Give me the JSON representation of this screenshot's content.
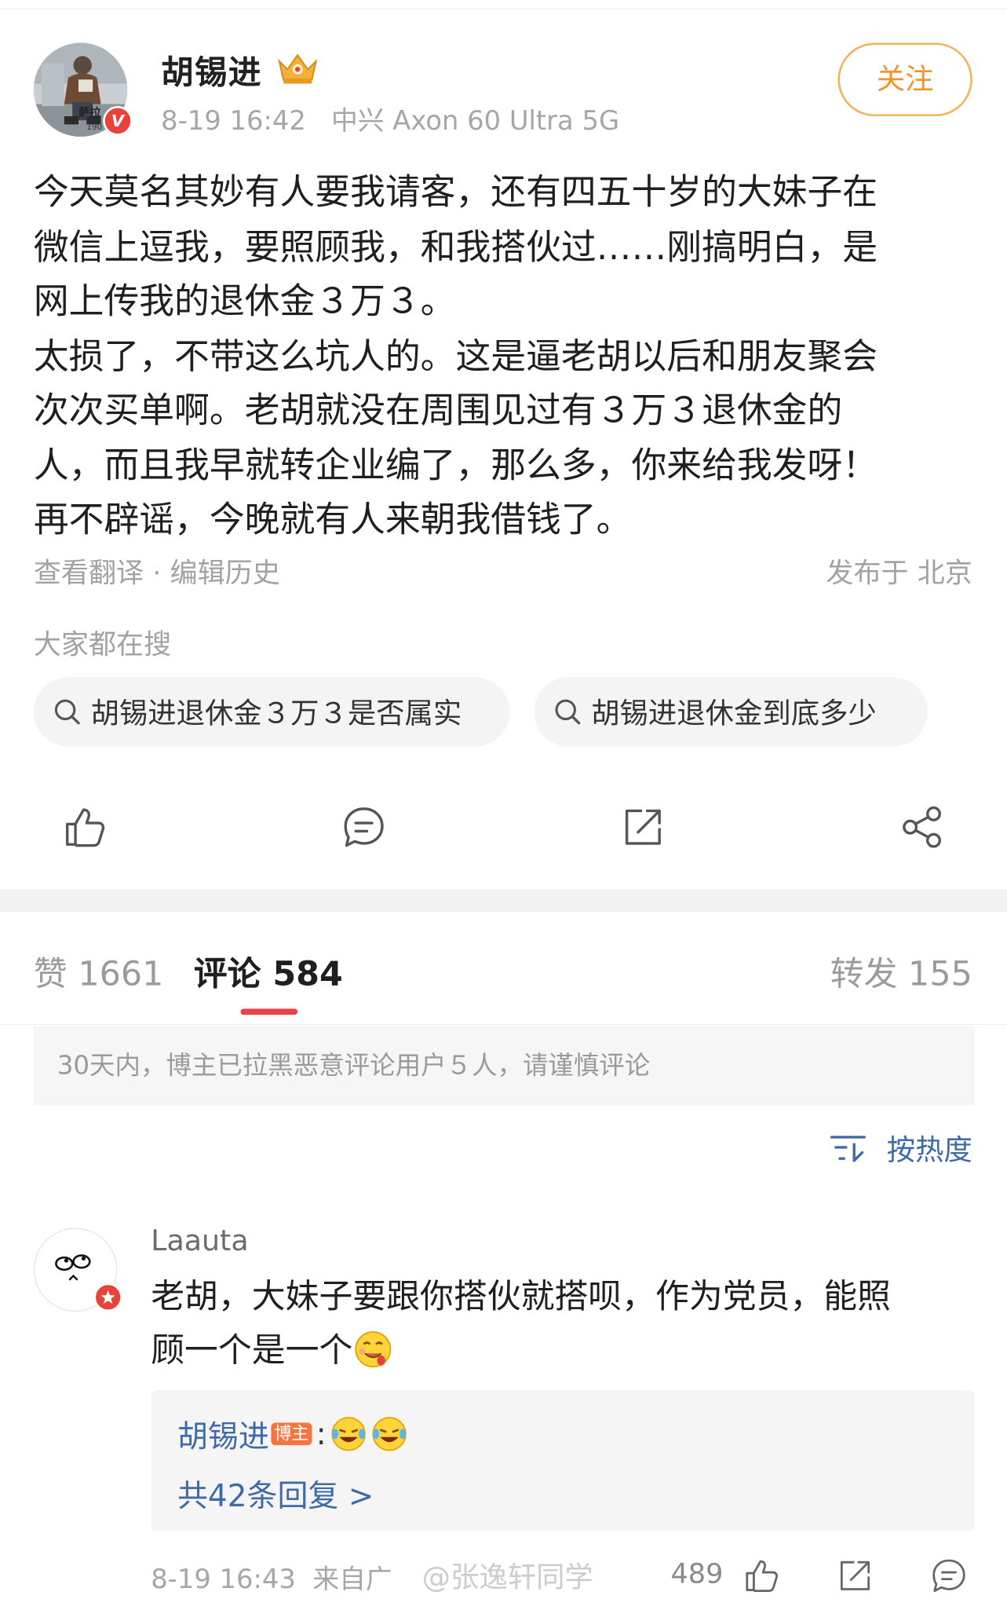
{
  "post": {
    "author": "胡锡进",
    "time": "8-19 16:42",
    "device": "中兴 Axon 60 Ultra 5G",
    "follow_label": "关注",
    "avatar_caption": "萨拉",
    "avatar_number": "190",
    "lines": [
      "今天莫名其妙有人要我请客，还有四五十岁的大妹子在",
      "微信上逗我，要照顾我，和我搭伙过……刚搞明白，是",
      "网上传我的退休金３万３。",
      "太损了，不带这么坑人的。这是逼老胡以后和朋友聚会",
      "次次买单啊。老胡就没在周围见过有３万３退休金的",
      "人，而且我早就转企业编了，那么多，你来给我发呀！",
      "再不辟谣，今晚就有人来朝我借钱了。"
    ],
    "translate_edit": "查看翻译 · 编辑历史",
    "location": "发布于 北京"
  },
  "hot_search": {
    "title": "大家都在搜",
    "chips": [
      "胡锡进退休金３万３是否属实",
      "胡锡进退休金到底多少"
    ]
  },
  "actions": [
    "like-icon",
    "comment-icon",
    "repost-icon",
    "share-icon"
  ],
  "tabs": {
    "likes": "赞 1661",
    "comments": "评论 584",
    "reposts": "转发 155"
  },
  "notice": "30天内，博主已拉黑恶意评论用户５人，请谨慎评论",
  "sort_label": "按热度",
  "comment": {
    "user": "Laauta",
    "text_line1": "老胡，大妹子要跟你搭伙就搭呗，作为党员，能照",
    "text_line2": "顾一个是一个",
    "reply_author": "胡锡进",
    "reply_badge": "博主",
    "reply_more": "共42条回复 >",
    "time": "8-19 16:43",
    "source": "来自广",
    "likes": "489"
  },
  "watermark": "@张逸轩同学",
  "colors": {
    "accent_orange": "#f09328",
    "link_blue": "#3f6aa8",
    "tab_underline": "#e8434a",
    "verified_red": "#e8433a"
  }
}
